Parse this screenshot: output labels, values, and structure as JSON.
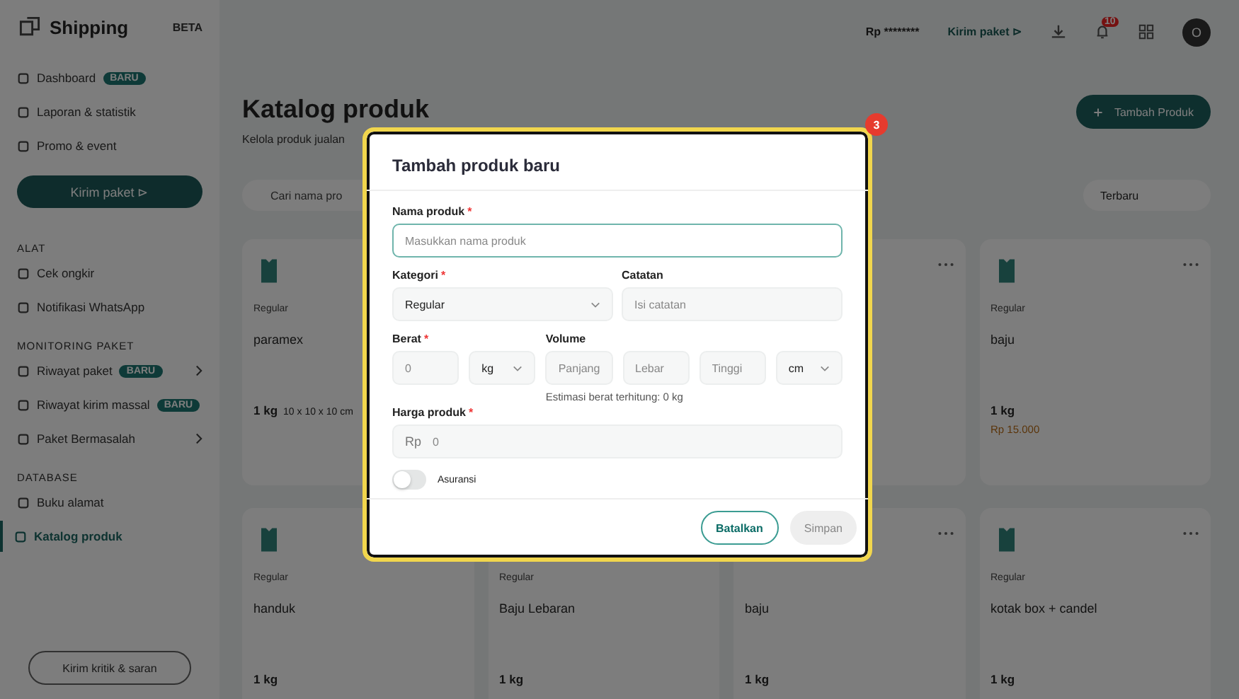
{
  "sidebar": {
    "logo": "Shipping",
    "beta": "BETA",
    "top_items": [
      {
        "label": "Dashboard",
        "badge": "BARU"
      },
      {
        "label": "Laporan & statistik"
      },
      {
        "label": "Promo & event"
      }
    ],
    "send_button": "Kirim paket ⊳",
    "sections": [
      {
        "title": "ALAT",
        "items": [
          {
            "label": "Cek ongkir",
            "selected": false
          },
          {
            "label": "Notifikasi WhatsApp",
            "selected": false
          }
        ]
      },
      {
        "title": "MONITORING PAKET",
        "items": [
          {
            "label": "Riwayat paket",
            "badge": "BARU",
            "chevron": true,
            "selected": false
          },
          {
            "label": "Riwayat kirim massal",
            "badge": "BARU",
            "chevron": false,
            "selected": false
          },
          {
            "label": "Paket Bermasalah",
            "chevron": true,
            "selected": false
          }
        ]
      },
      {
        "title": "DATABASE",
        "items": [
          {
            "label": "Buku alamat",
            "selected": false
          },
          {
            "label": "Katalog produk",
            "selected": true
          }
        ]
      }
    ],
    "feedback_button": "Kirim kritik & saran"
  },
  "header": {
    "balance": "Rp ********",
    "send_link": "Kirim paket ⊳",
    "notification_count": "10",
    "avatar": "O"
  },
  "page": {
    "title": "Katalog produk",
    "subtitle": "Kelola produk jualan",
    "add_button": "Tambah Produk",
    "search_placeholder": "Cari nama pro",
    "sort": "Terbaru"
  },
  "cards": [
    {
      "image": true,
      "tag": "Regular",
      "name": "paramex",
      "weight": "1 kg",
      "size": "10 x 10 x 10 cm"
    },
    {
      "menu": true
    },
    {
      "image": true,
      "menu": true,
      "tag": "Regular",
      "name": "baju",
      "weight": "1 kg",
      "price": "Rp 15.000"
    },
    {
      "image": true,
      "tag": "Regular",
      "name": "handuk",
      "weight": "1 kg"
    },
    {
      "tag": "Regular",
      "name": "Baju Lebaran",
      "weight": "1 kg"
    },
    {
      "menu": true,
      "name": "baju",
      "weight": "1 kg"
    },
    {
      "image": true,
      "menu": true,
      "tag": "Regular",
      "name": "kotak box + candel",
      "weight": "1 kg"
    }
  ],
  "modal": {
    "marker": "3",
    "title": "Tambah produk baru",
    "name_field": {
      "label": "Nama produk",
      "mark": "*",
      "placeholder": "Masukkan nama produk",
      "focused": true
    },
    "category": {
      "label": "Kategori",
      "mark": "*",
      "value": "Regular"
    },
    "note": {
      "label": "Catatan",
      "placeholder": "Isi catatan"
    },
    "weight": {
      "label": "Berat",
      "mark": "*",
      "placeholder": "0",
      "unit": "kg"
    },
    "volume": {
      "label": "Volume",
      "placeholders": [
        "Panjang",
        "Lebar",
        "Tinggi"
      ],
      "unit": "cm",
      "hint": "Estimasi berat terhitung: 0 kg"
    },
    "price": {
      "label": "Harga produk",
      "mark": "*",
      "prefix": "Rp",
      "placeholder": "0"
    },
    "insurance": {
      "label": "Asuransi",
      "on": false
    },
    "cancel_button": "Batalkan",
    "save_button": {
      "label": "Simpan",
      "disabled": true
    }
  }
}
